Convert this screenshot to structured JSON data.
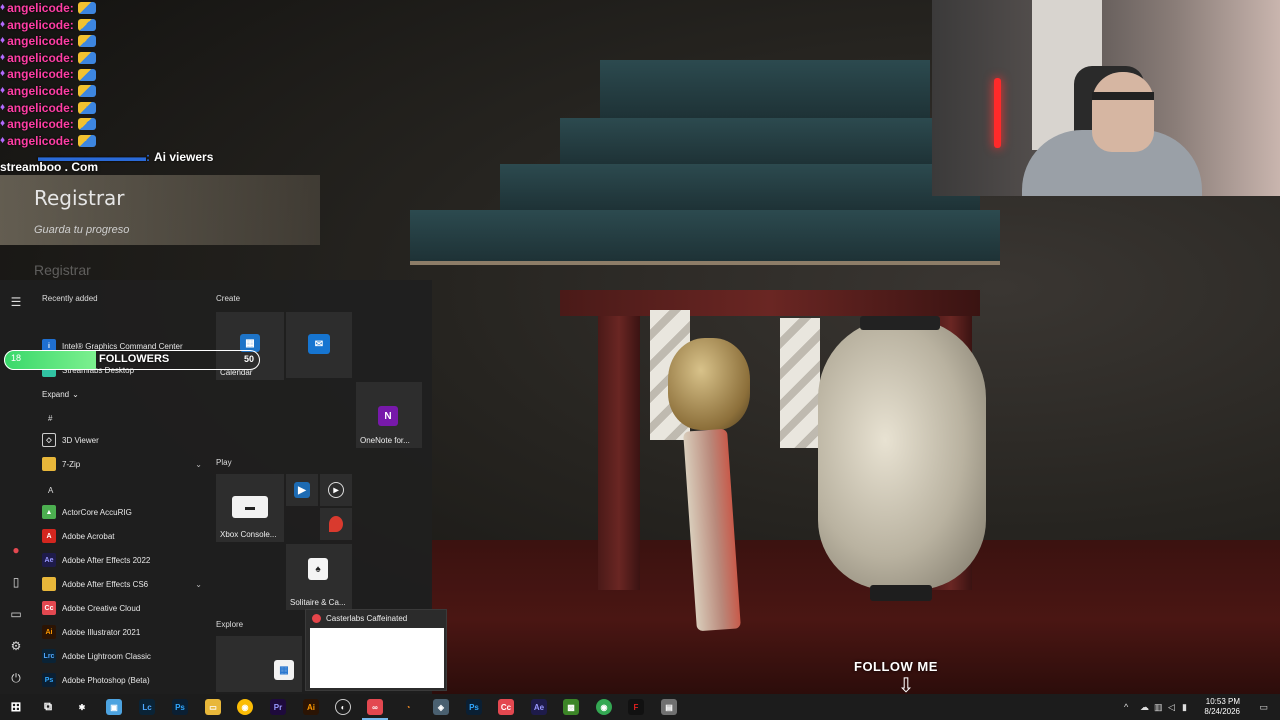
{
  "chat": {
    "username": "angelicode",
    "highlight_text": "Ai viewers",
    "ad_text": "streamboo . Com"
  },
  "register_panel": {
    "title": "Registrar",
    "subtitle": "Guarda tu progreso",
    "ghost_label": "Registrar"
  },
  "start_menu": {
    "recently_added": "Recently added",
    "recent_apps": [
      "Intel® Graphics Command Center",
      "Streamlabs Desktop"
    ],
    "expand_label": "Expand",
    "section_hash": "#",
    "section_a": "A",
    "apps": [
      {
        "label": "3D Viewer",
        "icon": "cube-icon",
        "color": "#444444"
      },
      {
        "label": "7-Zip",
        "icon": "folder-icon",
        "color": "#e8b73a",
        "chevron": "⌄"
      },
      {
        "label": "ActorCore AccuRIG",
        "icon": "accurig-icon",
        "color": "#4caf50"
      },
      {
        "label": "Adobe Acrobat",
        "icon": "acrobat-icon",
        "color": "#d3261f"
      },
      {
        "label": "Adobe After Effects 2022",
        "icon": "ae-icon",
        "color": "#1e1b4a"
      },
      {
        "label": "Adobe After Effects CS6",
        "icon": "folder-icon",
        "color": "#e8b73a",
        "chevron": "⌄"
      },
      {
        "label": "Adobe Creative Cloud",
        "icon": "cc-icon",
        "color": "#e34850"
      },
      {
        "label": "Adobe Illustrator 2021",
        "icon": "ai-icon",
        "color": "#2b1404"
      },
      {
        "label": "Adobe Lightroom Classic",
        "icon": "lrc-icon",
        "color": "#0a2336"
      },
      {
        "label": "Adobe Photoshop (Beta)",
        "icon": "ps-icon",
        "color": "#0a1f33"
      }
    ],
    "groups": {
      "create": "Create",
      "play": "Play",
      "explore": "Explore"
    },
    "tiles": {
      "calendar": "Calendar",
      "onenote": "OneNote for...",
      "xbox": "Xbox Console...",
      "solitaire": "Solitaire & Ca..."
    }
  },
  "followers": {
    "current": "18",
    "label": "FOLLOWERS",
    "goal": "50",
    "progress_fraction": 0.36
  },
  "casterlabs": {
    "title": "Casterlabs Caffeinated"
  },
  "follow_me": "FOLLOW ME",
  "clock": {
    "time": "10:53 PM",
    "date": "8/24/2026"
  },
  "colors": {
    "accent": "#76b9ed",
    "follower_bar": "#39d86a",
    "chat_user": "#ff3ea5"
  }
}
